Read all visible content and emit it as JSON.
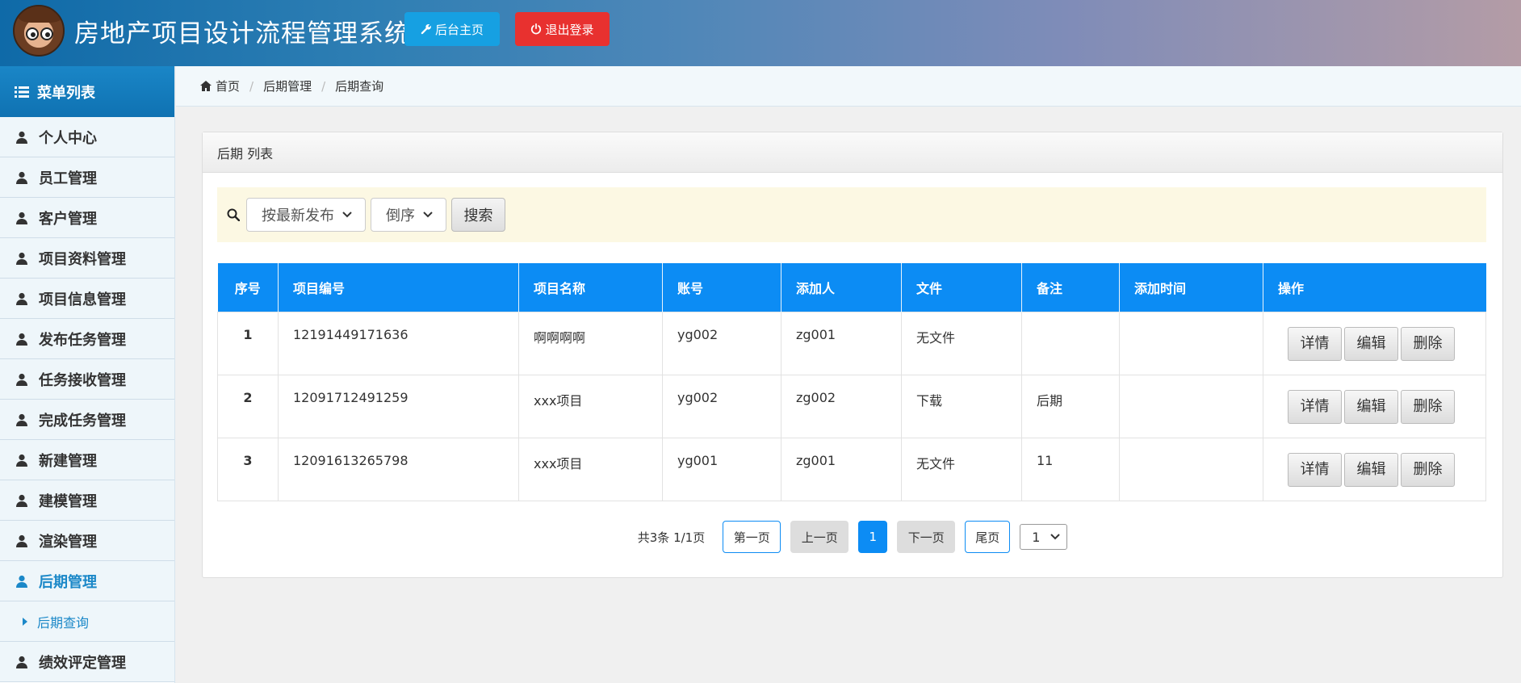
{
  "header": {
    "title": "房地产项目设计流程管理系统",
    "home_button": "后台主页",
    "logout_button": "退出登录"
  },
  "sidebar": {
    "heading": "菜单列表",
    "items": [
      {
        "label": "个人中心"
      },
      {
        "label": "员工管理"
      },
      {
        "label": "客户管理"
      },
      {
        "label": "项目资料管理"
      },
      {
        "label": "项目信息管理"
      },
      {
        "label": "发布任务管理"
      },
      {
        "label": "任务接收管理"
      },
      {
        "label": "完成任务管理"
      },
      {
        "label": "新建管理"
      },
      {
        "label": "建模管理"
      },
      {
        "label": "渲染管理"
      },
      {
        "label": "后期管理"
      },
      {
        "label": "绩效评定管理"
      }
    ],
    "active_sub": "后期查询"
  },
  "breadcrumb": [
    "首页",
    "后期管理",
    "后期查询"
  ],
  "panel": {
    "title": "后期 列表",
    "search": {
      "sort_value": "按最新发布",
      "order_value": "倒序",
      "button": "搜索"
    },
    "table": {
      "columns": [
        "序号",
        "项目编号",
        "项目名称",
        "账号",
        "添加人",
        "文件",
        "备注",
        "添加时间",
        "操作"
      ],
      "rows": [
        {
          "idx": "1",
          "code": "12191449171636",
          "name": "啊啊啊啊",
          "account": "yg002",
          "adder": "zg001",
          "file": "无文件",
          "note": "",
          "time": ""
        },
        {
          "idx": "2",
          "code": "12091712491259",
          "name": "xxx项目",
          "account": "yg002",
          "adder": "zg002",
          "file": "下载",
          "note": "后期",
          "time": ""
        },
        {
          "idx": "3",
          "code": "12091613265798",
          "name": "xxx项目",
          "account": "yg001",
          "adder": "zg001",
          "file": "无文件",
          "note": "11",
          "time": ""
        }
      ],
      "actions": {
        "detail": "详情",
        "edit": "编辑",
        "delete": "删除"
      }
    },
    "pager": {
      "summary": "共3条 1/1页",
      "first": "第一页",
      "prev": "上一页",
      "current": "1",
      "next": "下一页",
      "last": "尾页",
      "select_value": "1"
    }
  },
  "colors": {
    "accent": "#0c8cf4",
    "home_button": "#16a0e2",
    "logout_button": "#e8312f",
    "search_bg": "#fcf8e3"
  }
}
